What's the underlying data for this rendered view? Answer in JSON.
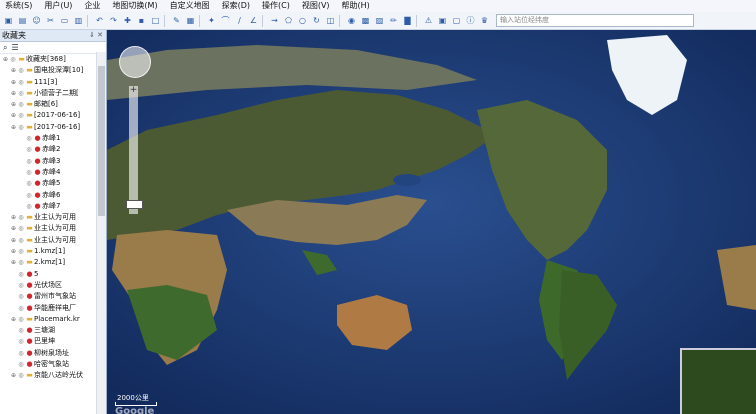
{
  "menu": [
    "系统(S)",
    "用户(U)",
    "企业",
    "地图切换(M)",
    "自定义地图",
    "探索(D)",
    "操作(C)",
    "视图(V)",
    "帮助(H)"
  ],
  "search_placeholder": "输入站位经纬度",
  "panel": {
    "title": "收藏夹",
    "pin": "⇓ ✕",
    "items": [
      {
        "label": "收藏夹[368]",
        "type": "folder",
        "level": 0
      },
      {
        "label": "国电投深潭[10]",
        "type": "folder",
        "level": 1
      },
      {
        "label": "111[3]",
        "type": "folder",
        "level": 1
      },
      {
        "label": "小德营子二期[",
        "type": "folder",
        "level": 1
      },
      {
        "label": "邮箱[6]",
        "type": "folder",
        "level": 1
      },
      {
        "label": "[2017-06-16]",
        "type": "folder",
        "level": 1
      },
      {
        "label": "[2017-06-16]",
        "type": "folder",
        "level": 1
      },
      {
        "label": "赤峰1",
        "type": "pin",
        "level": 2
      },
      {
        "label": "赤峰2",
        "type": "pin",
        "level": 2
      },
      {
        "label": "赤峰3",
        "type": "pin",
        "level": 2
      },
      {
        "label": "赤峰4",
        "type": "pin",
        "level": 2
      },
      {
        "label": "赤峰5",
        "type": "pin",
        "level": 2
      },
      {
        "label": "赤峰6",
        "type": "pin",
        "level": 2
      },
      {
        "label": "赤峰7",
        "type": "pin",
        "level": 2
      },
      {
        "label": "业主认为可用",
        "type": "folder",
        "level": 1
      },
      {
        "label": "业主认为可用",
        "type": "folder",
        "level": 1
      },
      {
        "label": "业主认为可用",
        "type": "folder",
        "level": 1
      },
      {
        "label": "1.kmz[1]",
        "type": "folder",
        "level": 1
      },
      {
        "label": "2.kmz[1]",
        "type": "folder",
        "level": 1
      },
      {
        "label": "5",
        "type": "pin",
        "level": 1
      },
      {
        "label": "光伏场区",
        "type": "pin",
        "level": 1
      },
      {
        "label": "雷州市气象站",
        "type": "pin",
        "level": 1
      },
      {
        "label": "华能鹿祥电厂",
        "type": "pin",
        "level": 1
      },
      {
        "label": "Placemark.kr",
        "type": "folder",
        "level": 1
      },
      {
        "label": "三塘湖",
        "type": "pin",
        "level": 1
      },
      {
        "label": "巴里坤",
        "type": "pin",
        "level": 1
      },
      {
        "label": "柳树泉场址",
        "type": "pin",
        "level": 1
      },
      {
        "label": "哈密气象站",
        "type": "pin",
        "level": 1
      },
      {
        "label": "京能八达岭光伏",
        "type": "folder",
        "level": 1
      }
    ]
  },
  "map": {
    "scale_label": "2000公里",
    "watermark": "Google"
  }
}
